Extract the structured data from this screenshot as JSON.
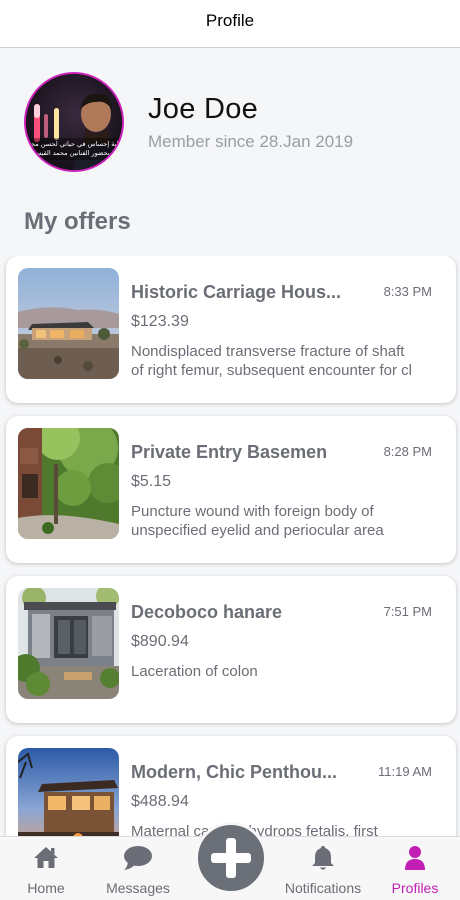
{
  "header": {
    "title": "Profile"
  },
  "profile": {
    "name": "Joe Doe",
    "member_since": "Member since 28.Jan 2019",
    "avatar_caption_line1": "ماية إحساس في حياتي لحسن محمد خوش",
    "avatar_caption_line2": "لقاء بحضور الفنانين محمد القيسي"
  },
  "section": {
    "title": "My offers"
  },
  "offers": [
    {
      "title": "Historic Carriage Hous...",
      "time": "8:33 PM",
      "price": "$123.39",
      "desc_line1": "Nondisplaced transverse fracture of shaft",
      "desc_line2": "of right femur, subsequent encounter for cl"
    },
    {
      "title": "Private Entry Basemen",
      "time": "8:28 PM",
      "price": "$5.15",
      "desc_line1": "Puncture wound with foreign body of",
      "desc_line2": "unspecified eyelid and periocular area"
    },
    {
      "title": "Decoboco hanare",
      "time": "7:51 PM",
      "price": "$890.94",
      "desc_line1": "Laceration of colon",
      "desc_line2": ""
    },
    {
      "title": "Modern, Chic Penthou...",
      "time": "11:19 AM",
      "price": "$488.94",
      "desc_line1": "Maternal care for hydrops fetalis, first",
      "desc_line2": ""
    }
  ],
  "tabbar": {
    "items": [
      {
        "label": "Home",
        "icon": "home-icon"
      },
      {
        "label": "Messages",
        "icon": "chat-bubble-icon"
      },
      {
        "label": "Notifications",
        "icon": "bell-icon"
      },
      {
        "label": "Profiles",
        "icon": "person-icon"
      }
    ],
    "add_icon": "plus-icon",
    "active_color": "#c21fb4",
    "inactive_color": "#6b6e76"
  }
}
